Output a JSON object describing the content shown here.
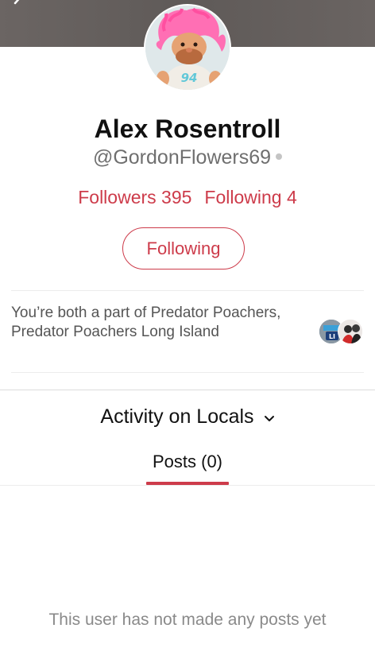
{
  "profile": {
    "display_name": "Alex Rosentroll",
    "handle": "@GordonFlowers69",
    "avatar_icon": "troll-doll-avatar",
    "avatar_shirt_text": "94"
  },
  "stats": {
    "followers_label": "Followers",
    "followers_count": "395",
    "following_label": "Following",
    "following_count": "4"
  },
  "follow_button_label": "Following",
  "mutual": {
    "text": "You’re both a part of Predator Poachers, Predator Poachers Long Island",
    "avatar_badge_text": "LI"
  },
  "activity": {
    "title": "Activity on Locals",
    "tab_label": "Posts (0)",
    "empty_message": "This user has not made any posts yet"
  },
  "colors": {
    "accent": "#cd3b4a",
    "muted_text": "#6f6f6f",
    "cover": "#625d5b"
  }
}
